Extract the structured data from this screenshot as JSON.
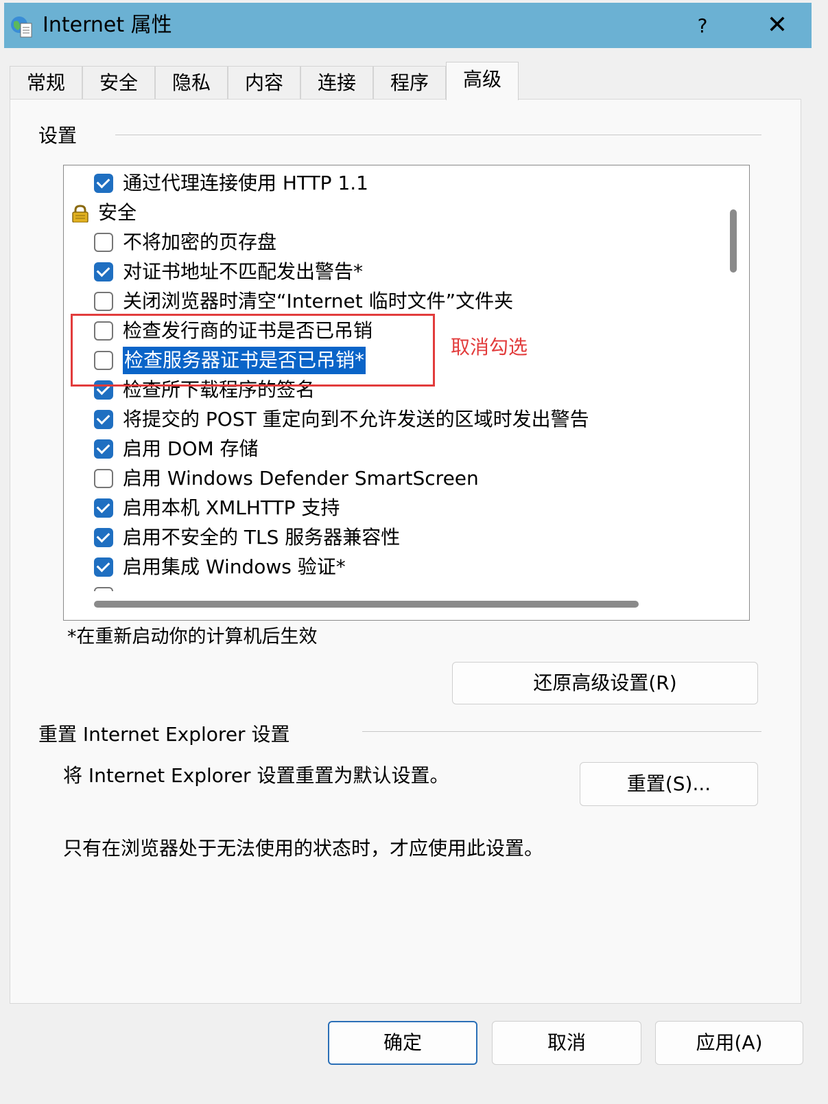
{
  "window": {
    "title": "Internet 属性",
    "help_label": "?",
    "close_label": "✕"
  },
  "tabs": [
    {
      "label": "常规"
    },
    {
      "label": "安全"
    },
    {
      "label": "隐私"
    },
    {
      "label": "内容"
    },
    {
      "label": "连接"
    },
    {
      "label": "程序"
    },
    {
      "label": "高级",
      "active": true
    }
  ],
  "settings": {
    "group_label": "设置",
    "items": [
      {
        "type": "checkbox",
        "checked": true,
        "label": "通过代理连接使用 HTTP 1.1"
      },
      {
        "type": "category",
        "icon": "lock-icon",
        "label": "安全"
      },
      {
        "type": "checkbox",
        "checked": false,
        "label": "不将加密的页存盘"
      },
      {
        "type": "checkbox",
        "checked": true,
        "label": "对证书地址不匹配发出警告*"
      },
      {
        "type": "checkbox",
        "checked": false,
        "label": "关闭浏览器时清空“Internet 临时文件”文件夹"
      },
      {
        "type": "checkbox",
        "checked": false,
        "label": "检查发行商的证书是否已吊销"
      },
      {
        "type": "checkbox",
        "checked": false,
        "label": "检查服务器证书是否已吊销*",
        "selected": true
      },
      {
        "type": "checkbox",
        "checked": true,
        "label": "检查所下载程序的签名"
      },
      {
        "type": "checkbox",
        "checked": true,
        "label": "将提交的 POST 重定向到不允许发送的区域时发出警告"
      },
      {
        "type": "checkbox",
        "checked": true,
        "label": "启用 DOM 存储"
      },
      {
        "type": "checkbox",
        "checked": false,
        "label": "启用 Windows Defender SmartScreen"
      },
      {
        "type": "checkbox",
        "checked": true,
        "label": "启用本机 XMLHTTP 支持"
      },
      {
        "type": "checkbox",
        "checked": true,
        "label": "启用不安全的 TLS 服务器兼容性"
      },
      {
        "type": "checkbox",
        "checked": true,
        "label": "启用集成 Windows 验证*"
      }
    ],
    "footnote": "*在重新启动你的计算机后生效",
    "restore_button": "还原高级设置(R)"
  },
  "annotation": {
    "text": "取消勾选",
    "color": "#e23c3c"
  },
  "reset": {
    "group_label": "重置 Internet Explorer 设置",
    "description": "将 Internet Explorer 设置重置为默认设置。",
    "button": "重置(S)...",
    "warning": "只有在浏览器处于无法使用的状态时，才应使用此设置。"
  },
  "footer": {
    "ok": "确定",
    "cancel": "取消",
    "apply": "应用(A)"
  },
  "colors": {
    "titlebar": "#6bb1d3",
    "checkbox_checked": "#1f6fc1",
    "selection": "#0a64c8"
  }
}
